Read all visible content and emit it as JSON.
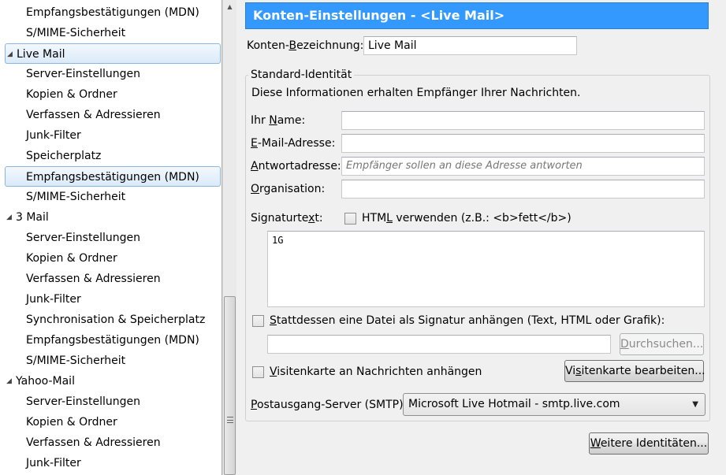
{
  "tree": [
    {
      "label": "Empfangsbestätigungen (MDN)",
      "level": "child",
      "selected": false
    },
    {
      "label": "S/MIME-Sicherheit",
      "level": "child",
      "selected": false
    },
    {
      "label": "Live Mail",
      "level": "root",
      "selected": true
    },
    {
      "label": "Server-Einstellungen",
      "level": "child",
      "selected": false
    },
    {
      "label": "Kopien & Ordner",
      "level": "child",
      "selected": false
    },
    {
      "label": "Verfassen & Adressieren",
      "level": "child",
      "selected": false
    },
    {
      "label": "Junk-Filter",
      "level": "child",
      "selected": false
    },
    {
      "label": "Speicherplatz",
      "level": "child",
      "selected": false
    },
    {
      "label": "Empfangsbestätigungen (MDN)",
      "level": "child",
      "selected": true
    },
    {
      "label": "S/MIME-Sicherheit",
      "level": "child",
      "selected": false
    },
    {
      "label": "3 Mail",
      "level": "root",
      "selected": false
    },
    {
      "label": "Server-Einstellungen",
      "level": "child",
      "selected": false
    },
    {
      "label": "Kopien & Ordner",
      "level": "child",
      "selected": false
    },
    {
      "label": "Verfassen & Adressieren",
      "level": "child",
      "selected": false
    },
    {
      "label": "Junk-Filter",
      "level": "child",
      "selected": false
    },
    {
      "label": "Synchronisation & Speicherplatz",
      "level": "child",
      "selected": false
    },
    {
      "label": "Empfangsbestätigungen (MDN)",
      "level": "child",
      "selected": false
    },
    {
      "label": "S/MIME-Sicherheit",
      "level": "child",
      "selected": false
    },
    {
      "label": "Yahoo-Mail",
      "level": "root",
      "selected": false
    },
    {
      "label": "Server-Einstellungen",
      "level": "child",
      "selected": false
    },
    {
      "label": "Kopien & Ordner",
      "level": "child",
      "selected": false
    },
    {
      "label": "Verfassen & Adressieren",
      "level": "child",
      "selected": false
    },
    {
      "label": "Junk-Filter",
      "level": "child",
      "selected": false
    }
  ],
  "panel": {
    "title": "Konten-Einstellungen - <Live Mail>",
    "account_name_label_pre": "Konten-",
    "account_name_label_u": "B",
    "account_name_label_post": "ezeichnung:",
    "account_name_value": "Live Mail",
    "identity_group_title": "Standard-Identität",
    "identity_description": "Diese Informationen erhalten Empfänger Ihrer Nachrichten.",
    "name_label_pre": "Ihr ",
    "name_label_u": "N",
    "name_label_post": "ame:",
    "name_value": "",
    "email_label_u": "E",
    "email_label_post": "-Mail-Adresse:",
    "email_value": "",
    "reply_label_u": "A",
    "reply_label_post": "ntwortadresse:",
    "reply_placeholder": "Empfänger sollen an diese Adresse antworten",
    "org_label_u": "O",
    "org_label_post": "rganisation:",
    "org_value": "",
    "signature_label_pre": "Signaturte",
    "signature_label_u": "x",
    "signature_label_post": "t:",
    "html_checkbox_pre": "HTM",
    "html_checkbox_u": "L",
    "html_checkbox_post": " verwenden (z.B.: <b>fett</b>)",
    "signature_text": "1G",
    "attach_file_label_u": "S",
    "attach_file_label_post": "tattdessen eine Datei als Signatur anhängen (Text, HTML oder Grafik):",
    "attach_file_path": "",
    "browse_button_u": "D",
    "browse_button_post": "urchsuchen...",
    "vcard_label_u": "V",
    "vcard_label_post": "isitenkarte an Nachrichten anhängen",
    "edit_vcard_button_pre": "Vi",
    "edit_vcard_button_u": "s",
    "edit_vcard_button_post": "itenkarte bearbeiten...",
    "smtp_label_u": "P",
    "smtp_label_post": "ostausgang-Server (SMTP):",
    "smtp_selected": "Microsoft Live Hotmail - smtp.live.com",
    "more_identities_u": "W",
    "more_identities_post": "eitere Identitäten..."
  },
  "colors": {
    "header_bg": "#3399ff",
    "selection_border": "#8ab5e2"
  }
}
